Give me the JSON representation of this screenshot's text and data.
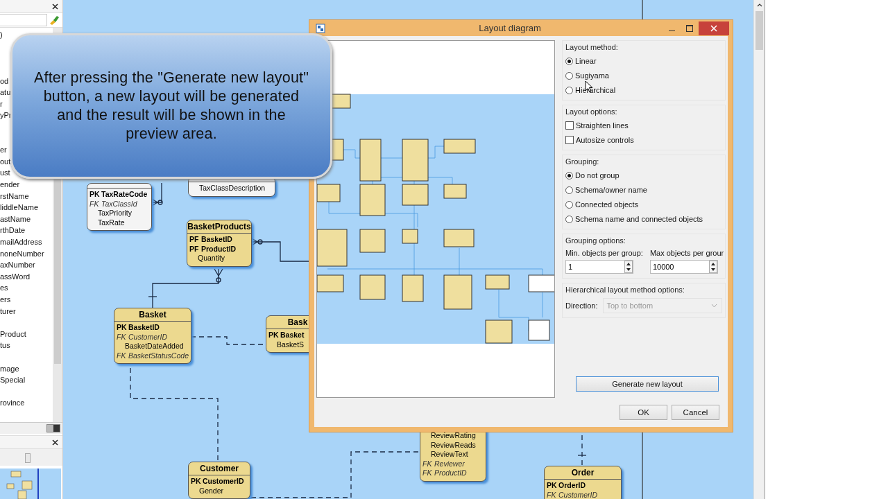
{
  "explorer_panel": {
    "groups": [
      {
        "items": [
          ")"
        ]
      },
      {
        "items": [
          "od",
          "atu",
          "r",
          "yPr"
        ]
      },
      {
        "items": [
          "er",
          "out",
          "ust",
          "ender",
          "rstName",
          "liddleName",
          "astName",
          "rthDate",
          "mailAddress",
          "noneNumber",
          "axNumber",
          "assWord",
          "es",
          "ers",
          "turer"
        ]
      },
      {
        "items": [
          "Product",
          "tus"
        ]
      },
      {
        "items": [
          "mage",
          "Special"
        ]
      },
      {
        "items": [
          "rovince"
        ]
      }
    ]
  },
  "overview_panel": {
    "zoom": {
      "level": 0.45
    }
  },
  "diagram": {
    "entities": [
      {
        "color": "#f4f4f4",
        "rows": [
          {
            "kind": "primary",
            "key": "PK",
            "name": "TaxRateCode"
          },
          {
            "kind": "foreign",
            "key": "FK",
            "name": "TaxClassId"
          },
          {
            "kind": "attribute",
            "name": "TaxPriority"
          },
          {
            "kind": "attribute",
            "name": "TaxRate"
          }
        ]
      },
      {
        "color": "#f4f4f4",
        "rows": [
          {
            "kind": "attribute",
            "name": "TaxClassDescription"
          }
        ]
      },
      {
        "color": "#ecd98f",
        "title": "BasketProducts",
        "rows": [
          {
            "kind": "primary",
            "key": "PF",
            "name": "BasketID"
          },
          {
            "kind": "primary",
            "key": "PF",
            "name": "ProductID"
          },
          {
            "kind": "attribute",
            "name": "Quantity"
          }
        ]
      },
      {
        "color": "#ecd98f",
        "title": "Basket",
        "rows": [
          {
            "kind": "primary",
            "key": "PK",
            "name": "BasketID"
          },
          {
            "kind": "foreign",
            "key": "FK",
            "name": "CustomerID"
          },
          {
            "kind": "attribute",
            "name": "BasketDateAdded"
          },
          {
            "kind": "foreign",
            "key": "FK",
            "name": "BasketStatusCode"
          }
        ]
      },
      {
        "color": "#ecd98f",
        "title": "Bask",
        "rows": [
          {
            "kind": "primary",
            "key": "PK",
            "name": "Basket"
          },
          {
            "kind": "attribute",
            "name": "BasketS"
          }
        ]
      },
      {
        "color": "#ecd98f",
        "title": "Customer",
        "rows": [
          {
            "kind": "primary",
            "key": "PK",
            "name": "CustomerID"
          },
          {
            "kind": "attribute",
            "name": "Gender"
          }
        ]
      },
      {
        "color": "#ecd98f",
        "rows": [
          {
            "kind": "attribute",
            "name": "ReviewRating"
          },
          {
            "kind": "attribute",
            "name": "ReviewReads"
          },
          {
            "kind": "attribute",
            "name": "ReviewText"
          },
          {
            "kind": "foreign",
            "key": "FK",
            "name": "Reviewer"
          },
          {
            "kind": "foreign",
            "key": "FK",
            "name": "ProductID"
          }
        ]
      },
      {
        "color": "#ecd98f",
        "title": "Order",
        "rows": [
          {
            "kind": "primary",
            "key": "PK",
            "name": "OrderID"
          },
          {
            "kind": "foreign",
            "key": "FK",
            "name": "CustomerID"
          }
        ]
      }
    ]
  },
  "callout": {
    "text": "After pressing the \"Generate new layout\" button, a new layout will be generated and the result will be shown in the preview area."
  },
  "dialog": {
    "title": "Layout diagram",
    "layout_method": {
      "label": "Layout method:",
      "options": [
        {
          "label": "Linear",
          "selected": true
        },
        {
          "label": "Sugiyama",
          "selected": false
        },
        {
          "label": "Hierarchical",
          "selected": false
        }
      ]
    },
    "layout_options": {
      "label": "Layout options:",
      "options": [
        {
          "label": "Straighten lines",
          "checked": false
        },
        {
          "label": "Autosize controls",
          "checked": false
        }
      ]
    },
    "grouping": {
      "label": "Grouping:",
      "options": [
        {
          "label": "Do not group",
          "selected": true
        },
        {
          "label": "Schema/owner name",
          "selected": false
        },
        {
          "label": "Connected objects",
          "selected": false
        },
        {
          "label": "Schema name and connected objects",
          "selected": false
        }
      ]
    },
    "grouping_options": {
      "label": "Grouping options:",
      "fields": [
        {
          "label": "Min. objects per group:",
          "value": "1"
        },
        {
          "label": "Max objects per grour",
          "value": "10000"
        }
      ]
    },
    "hierarchical_options": {
      "label": "Hierarchical layout method options:",
      "direction_label": "Direction:",
      "direction": {
        "value": "Top to bottom",
        "disabled": true
      }
    },
    "generate_button": "Generate new layout",
    "buttons": [
      "OK",
      "Cancel"
    ]
  }
}
